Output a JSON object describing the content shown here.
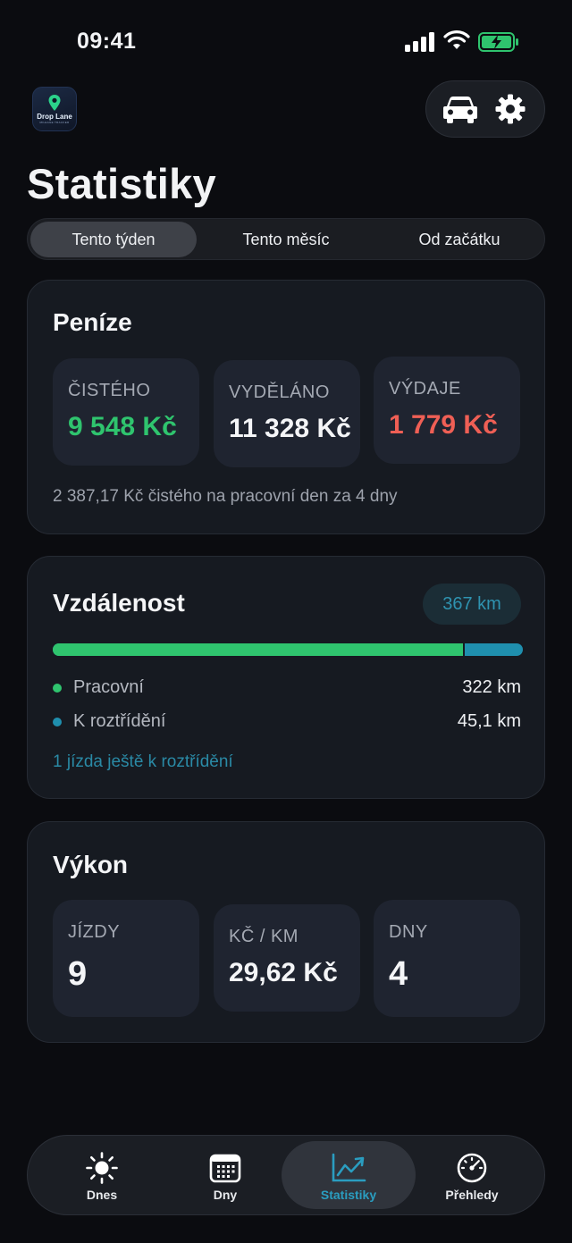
{
  "status_bar": {
    "time": "09:41"
  },
  "header": {
    "logo_text": "Drop Lane",
    "logo_subtext": "MILEAGE TRACKER",
    "title": "Statistiky"
  },
  "segments": [
    {
      "label": "Tento týden",
      "selected": true
    },
    {
      "label": "Tento měsíc",
      "selected": false
    },
    {
      "label": "Od začátku",
      "selected": false
    }
  ],
  "money": {
    "title": "Peníze",
    "tiles": [
      {
        "label": "ČISTÉHO",
        "value": "9 548 Kč"
      },
      {
        "label": "VYDĚLÁNO",
        "value": "11 328 Kč"
      },
      {
        "label": "VÝDAJE",
        "value": "1 779 Kč"
      }
    ],
    "note": "2 387,17 Kč čistého na pracovní den za 4 dny"
  },
  "distance": {
    "title": "Vzdálenost",
    "total": "367 km",
    "work_fraction": 0.877,
    "legend": [
      {
        "label": "Pracovní",
        "value": "322 km",
        "color": "#2fc46e"
      },
      {
        "label": "K roztřídění",
        "value": "45,1 km",
        "color": "#1f8fae"
      }
    ],
    "link": "1 jízda ještě k roztřídění"
  },
  "performance": {
    "title": "Výkon",
    "tiles": [
      {
        "label": "JÍZDY",
        "value": "9"
      },
      {
        "label": "KČ / KM",
        "value": "29,62 Kč"
      },
      {
        "label": "DNY",
        "value": "4"
      }
    ]
  },
  "tabs": [
    {
      "label": "Dnes",
      "icon": "sun-icon",
      "active": false
    },
    {
      "label": "Dny",
      "icon": "calendar-icon",
      "active": false
    },
    {
      "label": "Statistiky",
      "icon": "chart-icon",
      "active": true
    },
    {
      "label": "Přehledy",
      "icon": "gauge-icon",
      "active": false
    }
  ],
  "colors": {
    "accent": "#2a9dc0",
    "positive": "#2fc46e",
    "negative": "#ef5f55"
  }
}
